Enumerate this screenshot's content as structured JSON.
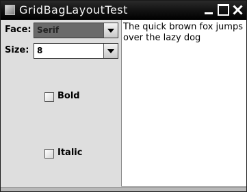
{
  "window": {
    "title": "GridBagLayoutTest"
  },
  "face": {
    "label": "Face:",
    "value": "Serif"
  },
  "size": {
    "label": "Size:",
    "value": "8"
  },
  "bold": {
    "label": "Bold",
    "checked": false
  },
  "italic": {
    "label": "Italic",
    "checked": false
  },
  "sample_text": "The quick brown fox jumps over the lazy dog",
  "icons": {
    "app": "java-window-icon",
    "minimize": "minimize-icon",
    "maximize": "maximize-icon",
    "close": "close-icon",
    "dropdown": "chevron-down-icon"
  }
}
